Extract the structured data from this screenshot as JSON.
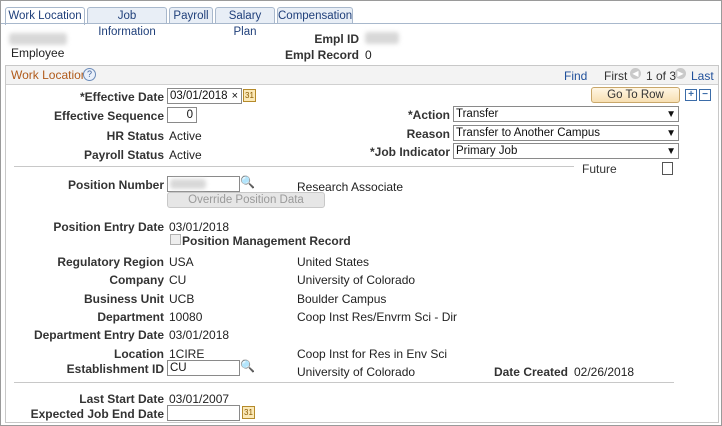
{
  "tabs": [
    {
      "label": "Work Location",
      "active": true
    },
    {
      "label": "Job Information",
      "active": false
    },
    {
      "label": "Payroll",
      "active": false
    },
    {
      "label": "Salary Plan",
      "active": false
    },
    {
      "label": "Compensation",
      "active": false
    }
  ],
  "header": {
    "employee_label": "Employee",
    "empl_id_label": "Empl ID",
    "empl_record_label": "Empl Record",
    "empl_record_value": "0"
  },
  "section": {
    "title": "Work Location",
    "help_icon": "question-circle-icon",
    "find": "Find",
    "first": "First",
    "range": "1 of 3",
    "last": "Last",
    "go_to_row": "Go To Row",
    "add": "+",
    "remove": "−"
  },
  "effective": {
    "effective_date_label": "*Effective Date",
    "effective_date": "03/01/2018",
    "clear_glyph": "×",
    "effective_sequence_label": "Effective Sequence",
    "effective_sequence": "0",
    "hr_status_label": "HR Status",
    "hr_status": "Active",
    "payroll_status_label": "Payroll Status",
    "payroll_status": "Active",
    "action_label": "*Action",
    "action": "Transfer",
    "reason_label": "Reason",
    "reason": "Transfer to Another Campus",
    "job_indicator_label": "*Job Indicator",
    "job_indicator": "Primary Job",
    "future": "Future"
  },
  "position": {
    "position_number_label": "Position Number",
    "position_title": "Research Associate",
    "override_button": "Override Position Data",
    "entry_date_label": "Position Entry Date",
    "entry_date": "03/01/2018",
    "mgmt_record_label": "Position Management Record"
  },
  "details": {
    "regulatory_region_label": "Regulatory Region",
    "regulatory_region": "USA",
    "regulatory_region_desc": "United States",
    "company_label": "Company",
    "company": "CU",
    "company_desc": "University of Colorado",
    "business_unit_label": "Business Unit",
    "business_unit": "UCB",
    "business_unit_desc": "Boulder Campus",
    "department_label": "Department",
    "department": "10080",
    "department_desc": "Coop Inst Res/Envrm Sci - Dir",
    "dept_entry_date_label": "Department Entry Date",
    "dept_entry_date": "03/01/2018",
    "location_label": "Location",
    "location": "1CIRE",
    "location_desc": "Coop Inst for Res in Env Sci",
    "establishment_label": "Establishment ID",
    "establishment": "CU",
    "establishment_desc": "University of Colorado",
    "date_created_label": "Date Created",
    "date_created": "02/26/2018"
  },
  "dates": {
    "last_start_label": "Last Start Date",
    "last_start": "03/01/2007",
    "expected_end_label": "Expected Job End Date",
    "expected_end": ""
  },
  "colors": {
    "link": "#1f4f9a",
    "tab_border": "#a8b8cc",
    "button_fill": "#f7dfb2"
  }
}
